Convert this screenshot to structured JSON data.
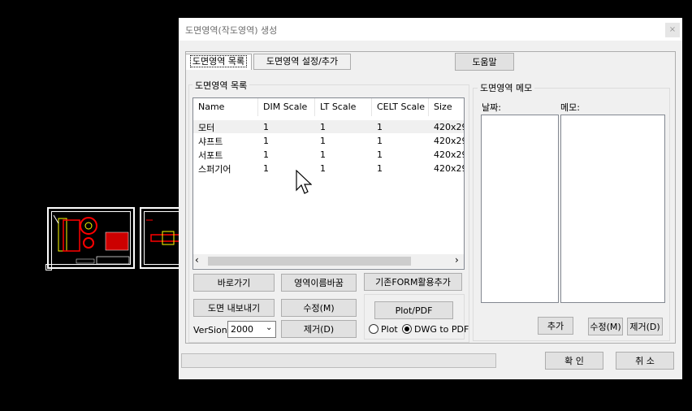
{
  "dialog": {
    "title": "도면영역(작도영역) 생성",
    "close_label": "×",
    "tabs": [
      {
        "label": "도면영역 목록",
        "active": true
      },
      {
        "label": "도면영역 설정/추가",
        "active": false
      }
    ],
    "help_label": "도움말"
  },
  "list_group": {
    "label": "도면영역 목록",
    "columns": [
      "Name",
      "DIM Scale",
      "LT Scale",
      "CELT Scale",
      "Size"
    ],
    "rows": [
      [
        "모터",
        "1",
        "1",
        "1",
        "420x29"
      ],
      [
        "샤프트",
        "1",
        "1",
        "1",
        "420x29"
      ],
      [
        "서포트",
        "1",
        "1",
        "1",
        "420x29"
      ],
      [
        "스퍼기어",
        "1",
        "1",
        "1",
        "420x29"
      ]
    ]
  },
  "buttons": {
    "goto": "바로가기",
    "rename": "영역이름바꿈",
    "add_form": "기존FORM활용추가",
    "export": "도면 내보내기",
    "edit": "수정(M)",
    "delete": "제거(D)",
    "plot_pdf": "Plot/PDF"
  },
  "version": {
    "label": "VerSion:",
    "value": "2000"
  },
  "output_mode": {
    "plot": "Plot",
    "dwg_to_pdf": "DWG to PDF",
    "selected": "dwg_to_pdf"
  },
  "memo_group": {
    "label": "도면영역 메모",
    "date_label": "날짜:",
    "memo_label": "메모:",
    "add": "추가",
    "edit": "수정(M)",
    "delete": "제거(D)"
  },
  "footer": {
    "ok": "확 인",
    "cancel": "취 소"
  }
}
